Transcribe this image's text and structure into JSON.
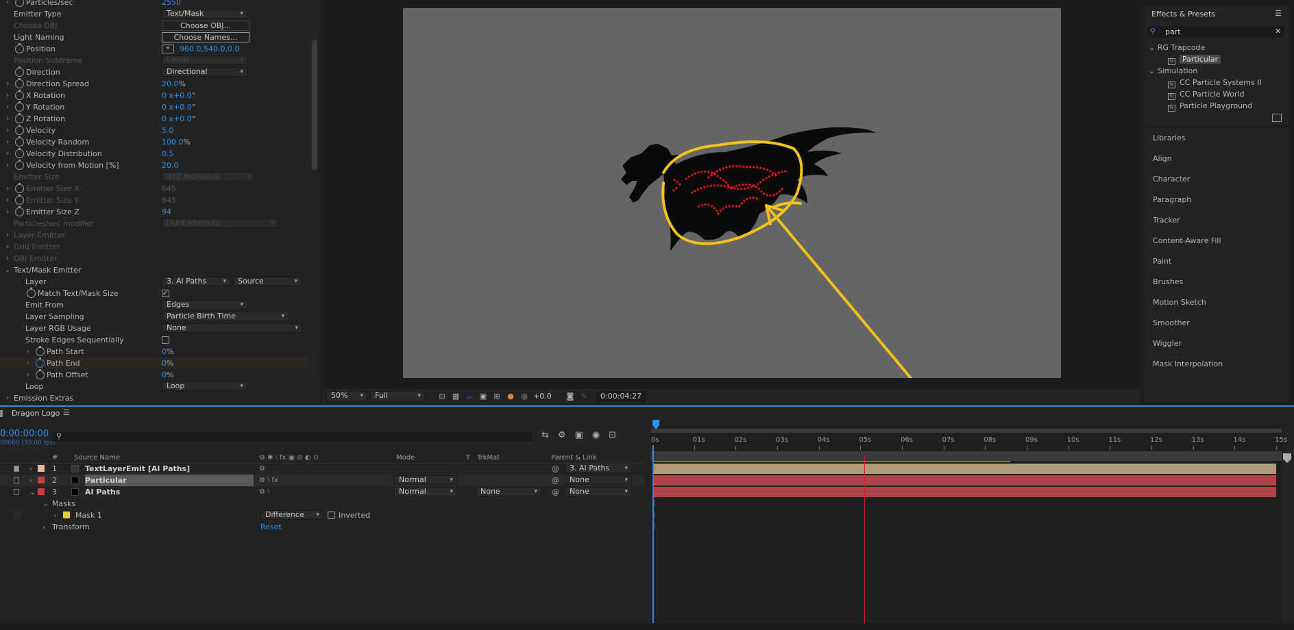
{
  "effect_controls": {
    "rows": [
      {
        "label": "Particles/sec",
        "value": "2550",
        "indent": 1,
        "twirl": true,
        "stopwatch": true,
        "type": "num"
      },
      {
        "label": "Emitter Type",
        "value": "Text/Mask",
        "indent": 0,
        "type": "dropdown"
      },
      {
        "label": "Choose OBJ",
        "value": "Choose OBJ...",
        "indent": 0,
        "type": "button",
        "disabled": true
      },
      {
        "label": "Light Naming",
        "value": "Choose Names...",
        "indent": 0,
        "type": "button"
      },
      {
        "label": "Position",
        "value": "960.0,540.0,0.0",
        "indent": 1,
        "stopwatch": true,
        "type": "pos"
      },
      {
        "label": "Position Subframe",
        "value": "Linear",
        "indent": 0,
        "type": "dropdown",
        "disabled": true
      },
      {
        "label": "Direction",
        "value": "Directional",
        "indent": 1,
        "stopwatch": true,
        "type": "dropdown"
      },
      {
        "label": "Direction Spread",
        "value": "20.0",
        "unit": "%",
        "indent": 1,
        "twirl": true,
        "stopwatch": true,
        "type": "num"
      },
      {
        "label": "X Rotation",
        "value": "0 x+0.0",
        "unit": "°",
        "indent": 1,
        "twirl": true,
        "stopwatch": true,
        "type": "num"
      },
      {
        "label": "Y Rotation",
        "value": "0 x+0.0",
        "unit": "°",
        "indent": 1,
        "twirl": true,
        "stopwatch": true,
        "type": "num"
      },
      {
        "label": "Z Rotation",
        "value": "0 x+0.0",
        "unit": "°",
        "indent": 1,
        "twirl": true,
        "stopwatch": true,
        "type": "num"
      },
      {
        "label": "Velocity",
        "value": "5.0",
        "indent": 1,
        "twirl": true,
        "stopwatch": true,
        "type": "num"
      },
      {
        "label": "Velocity Random",
        "value": "100.0",
        "unit": "%",
        "indent": 1,
        "twirl": true,
        "stopwatch": true,
        "type": "num"
      },
      {
        "label": "Velocity Distribution",
        "value": "0.5",
        "indent": 1,
        "twirl": true,
        "stopwatch": true,
        "type": "num"
      },
      {
        "label": "Velocity from Motion [%]",
        "value": "20.0",
        "indent": 1,
        "twirl": true,
        "stopwatch": true,
        "type": "num"
      },
      {
        "label": "Emitter Size",
        "value": "XYZ Individual",
        "indent": 0,
        "type": "dropdown",
        "disabled": true
      },
      {
        "label": "Emitter Size X",
        "value": "645",
        "indent": 1,
        "twirl": true,
        "stopwatch": true,
        "type": "num",
        "disabled": true
      },
      {
        "label": "Emitter Size Y",
        "value": "645",
        "indent": 1,
        "twirl": true,
        "stopwatch": true,
        "type": "num",
        "disabled": true
      },
      {
        "label": "Emitter Size Z",
        "value": "94",
        "indent": 1,
        "twirl": true,
        "stopwatch": true,
        "type": "num"
      },
      {
        "label": "Particles/sec modifier",
        "value": "Light Intensity",
        "indent": 0,
        "type": "dropdown",
        "disabled": true
      },
      {
        "label": "Layer Emitter",
        "indent": 0,
        "twirl": true,
        "type": "group",
        "disabled": true
      },
      {
        "label": "Grid Emitter",
        "indent": 0,
        "twirl": true,
        "type": "group",
        "disabled": true
      },
      {
        "label": "OBJ Emitter",
        "indent": 0,
        "twirl": true,
        "type": "group",
        "disabled": true
      },
      {
        "label": "Text/Mask Emitter",
        "indent": 0,
        "twirl": true,
        "open": true,
        "type": "group"
      },
      {
        "label": "Layer",
        "value": "3. AI Paths",
        "value2": "Source",
        "indent": 2,
        "type": "layer"
      },
      {
        "label": "Match Text/Mask Size",
        "indent": 2,
        "stopwatch": true,
        "type": "checkbox",
        "checked": true
      },
      {
        "label": "Emit From",
        "value": "Edges",
        "indent": 2,
        "type": "dropdown"
      },
      {
        "label": "Layer Sampling",
        "value": "Particle Birth Time",
        "indent": 2,
        "type": "dropdown"
      },
      {
        "label": "Layer RGB Usage",
        "value": "None",
        "indent": 2,
        "type": "dropdown"
      },
      {
        "label": "Stroke Edges Sequentially",
        "indent": 2,
        "type": "checkbox",
        "checked": false
      },
      {
        "label": "Path Start",
        "value": "0",
        "unit": "%",
        "indent": 3,
        "twirl": true,
        "stopwatch": true,
        "type": "num"
      },
      {
        "label": "Path End",
        "value": "0",
        "unit": "%",
        "indent": 3,
        "twirl": true,
        "stopwatch": true,
        "keyed": true,
        "type": "num"
      },
      {
        "label": "Path Offset",
        "value": "0",
        "unit": "%",
        "indent": 3,
        "twirl": true,
        "stopwatch": true,
        "type": "num"
      },
      {
        "label": "Loop",
        "value": "Loop",
        "indent": 2,
        "type": "dropdown"
      },
      {
        "label": "Emission Extras",
        "indent": 0,
        "twirl": true,
        "type": "group"
      }
    ]
  },
  "viewer": {
    "zoom": "50%",
    "resolution": "Full",
    "exposure": "+0.0",
    "timecode": "0:00:04:27"
  },
  "effects_presets": {
    "title": "Effects & Presets",
    "search": "part",
    "groups": [
      {
        "name": "RG Trapcode",
        "items": [
          "Particular"
        ],
        "selected": "Particular"
      },
      {
        "name": "Simulation",
        "items": [
          "CC Particle Systems II",
          "CC Particle World",
          "Particle Playground"
        ]
      }
    ]
  },
  "side_panels": [
    "Libraries",
    "Align",
    "Character",
    "Paragraph",
    "Tracker",
    "Content-Aware Fill",
    "Paint",
    "Brushes",
    "Motion Sketch",
    "Smoother",
    "Wiggler",
    "Mask Interpolation"
  ],
  "timeline": {
    "comp_name": "Dragon Logo",
    "timecode": "0:00:00:00",
    "fps": "00000 (30.00 fps)",
    "columns": {
      "num": "#",
      "source": "Source Name",
      "mode": "Mode",
      "t": "T",
      "trkmat": "TrkMat",
      "parent": "Parent & Link"
    },
    "layers": [
      {
        "num": "1",
        "name": "TextLayerEmit [AI Paths]",
        "color": "#e6b896",
        "mode": "",
        "trkmat": "",
        "parent": "3. AI Paths",
        "selected": false
      },
      {
        "num": "2",
        "name": "Particular",
        "color": "#c83c3c",
        "mode": "Normal",
        "trkmat": "",
        "parent": "None",
        "selected": true
      },
      {
        "num": "3",
        "name": "AI Paths",
        "color": "#c83c3c",
        "mode": "Normal",
        "trkmat": "None",
        "parent": "None",
        "selected": false
      }
    ],
    "masks_label": "Masks",
    "mask": {
      "name": "Mask 1",
      "mode": "Difference",
      "inverted": "Inverted"
    },
    "transform_label": "Transform",
    "reset_label": "Reset",
    "ruler": [
      "0s",
      "01s",
      "02s",
      "03s",
      "04s",
      "05s",
      "06s",
      "07s",
      "08s",
      "09s",
      "10s",
      "11s",
      "12s",
      "13s",
      "14s",
      "15s"
    ],
    "playhead_seconds": 5.1,
    "work_area_end_seconds": 8.6
  },
  "colors": {
    "accent": "#2d8ceb",
    "annotation": "#f2c21a",
    "playhead": "#d02020",
    "layer_bar_tan": "#b09a7c",
    "layer_bar_red": "#b0444a"
  }
}
